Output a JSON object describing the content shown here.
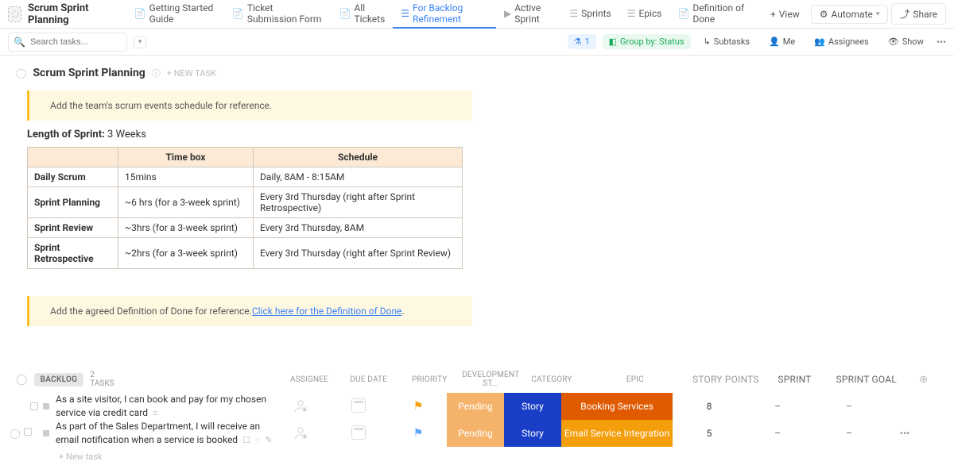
{
  "header": {
    "board_title": "Scrum Sprint Planning",
    "tabs": [
      {
        "label": "Getting Started Guide"
      },
      {
        "label": "Ticket Submission Form"
      },
      {
        "label": "All Tickets"
      },
      {
        "label": "For Backlog Refinement"
      },
      {
        "label": "Active Sprint"
      },
      {
        "label": "Sprints"
      },
      {
        "label": "Epics"
      },
      {
        "label": "Definition of Done"
      }
    ],
    "active_tab_index": 3,
    "view_btn": "View",
    "automate_btn": "Automate",
    "share_btn": "Share"
  },
  "subbar": {
    "search_placeholder": "Search tasks...",
    "filter_count": "1",
    "group_by": "Group by: Status",
    "subtasks": "Subtasks",
    "me": "Me",
    "assignees": "Assignees",
    "show": "Show"
  },
  "section": {
    "title": "Scrum Sprint Planning",
    "new_task": "+ NEW TASK",
    "callout1": "Add the team's scrum events schedule for reference.",
    "sprint_length_label": "Length of Sprint:",
    "sprint_length_value": "3 Weeks",
    "table_headers": [
      "",
      "Time box",
      "Schedule"
    ],
    "table_rows": [
      {
        "name": "Daily Scrum",
        "timebox": "15mins",
        "schedule": "Daily, 8AM - 8:15AM"
      },
      {
        "name": "Sprint Planning",
        "timebox": "~6 hrs (for a 3-week sprint)",
        "schedule": "Every 3rd Thursday (right after Sprint Retrospective)"
      },
      {
        "name": "Sprint Review",
        "timebox": "~3hrs (for a 3-week sprint)",
        "schedule": "Every 3rd Thursday, 8AM"
      },
      {
        "name": "Sprint Retrospective",
        "timebox": "~2hrs (for a 3-week sprint)",
        "schedule": "Every 3rd Thursday (right after Sprint Review)"
      }
    ],
    "callout2_text": "Add the agreed Definition of Done for reference. ",
    "callout2_link": "Click here for the Definition of Done"
  },
  "grid": {
    "group_label": "BACKLOG",
    "task_count": "2 TASKS",
    "columns": {
      "assignee": "ASSIGNEE",
      "due_date": "DUE DATE",
      "priority": "PRIORITY",
      "dev_status": "DEVELOPMENT ST...",
      "category": "CATEGORY",
      "epic": "EPIC",
      "story_points": "STORY POINTS",
      "sprint": "SPRINT",
      "sprint_goal": "SPRINT GOAL"
    },
    "rows": [
      {
        "name": "As a site visitor, I can book and pay for my chosen service via credit card",
        "dev_status": "Pending",
        "category": "Story",
        "epic": "Booking Services",
        "epic_class": "epic-booking",
        "story_points": "8",
        "sprint": "–",
        "sprint_goal": "–",
        "flag_class": "orange",
        "show_more": false,
        "show_mini": false
      },
      {
        "name": "As part of the Sales Department, I will receive an email notification when a service is booked",
        "dev_status": "Pending",
        "category": "Story",
        "epic": "Email Service Integration",
        "epic_class": "epic-email",
        "story_points": "5",
        "sprint": "–",
        "sprint_goal": "–",
        "flag_class": "blue",
        "show_more": true,
        "show_mini": true
      }
    ],
    "new_task": "+ New task"
  }
}
